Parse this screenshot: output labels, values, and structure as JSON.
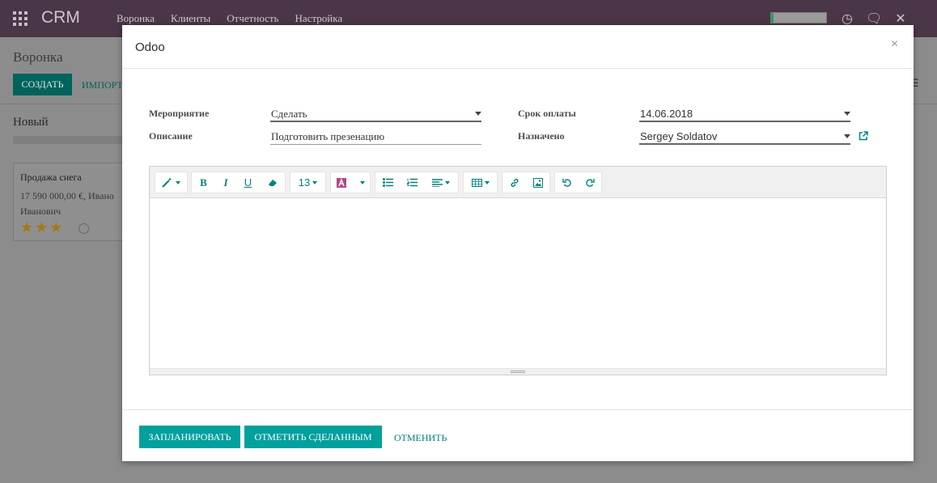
{
  "app": {
    "brand": "CRM",
    "nav": [
      "Воронка",
      "Клиенты",
      "Отчетность",
      "Настройка"
    ],
    "activity_progress": 0.05
  },
  "background": {
    "page_title": "Воронка",
    "create_label": "СОЗДАТЬ",
    "import_label": "ИМПОРТ",
    "column_title": "Новый",
    "card": {
      "title": "Продажа снега",
      "amount": "17 590 000,00 €, Ивано",
      "person": "Иванович",
      "stars": 3
    }
  },
  "modal": {
    "title": "Odoo",
    "close": "×",
    "fields": {
      "activity_label": "Мероприятие",
      "activity_value": "Сделать",
      "description_label": "Описание",
      "description_value": "Подготовить презенацию",
      "due_label": "Срок оплаты",
      "due_value": "14.06.2018",
      "assigned_label": "Назначено",
      "assigned_value": "Sergey Soldatov"
    },
    "editor": {
      "font_size": "13"
    },
    "footer": {
      "schedule_label": "ЗАПЛАНИРОВАТЬ",
      "mark_done_label": "ОТМЕТИТЬ СДЕЛАННЫМ",
      "cancel_label": "ОТМЕНИТЬ"
    }
  },
  "colors": {
    "topbar": "#4a3646",
    "primary": "#00a09d",
    "link": "#00827b"
  }
}
